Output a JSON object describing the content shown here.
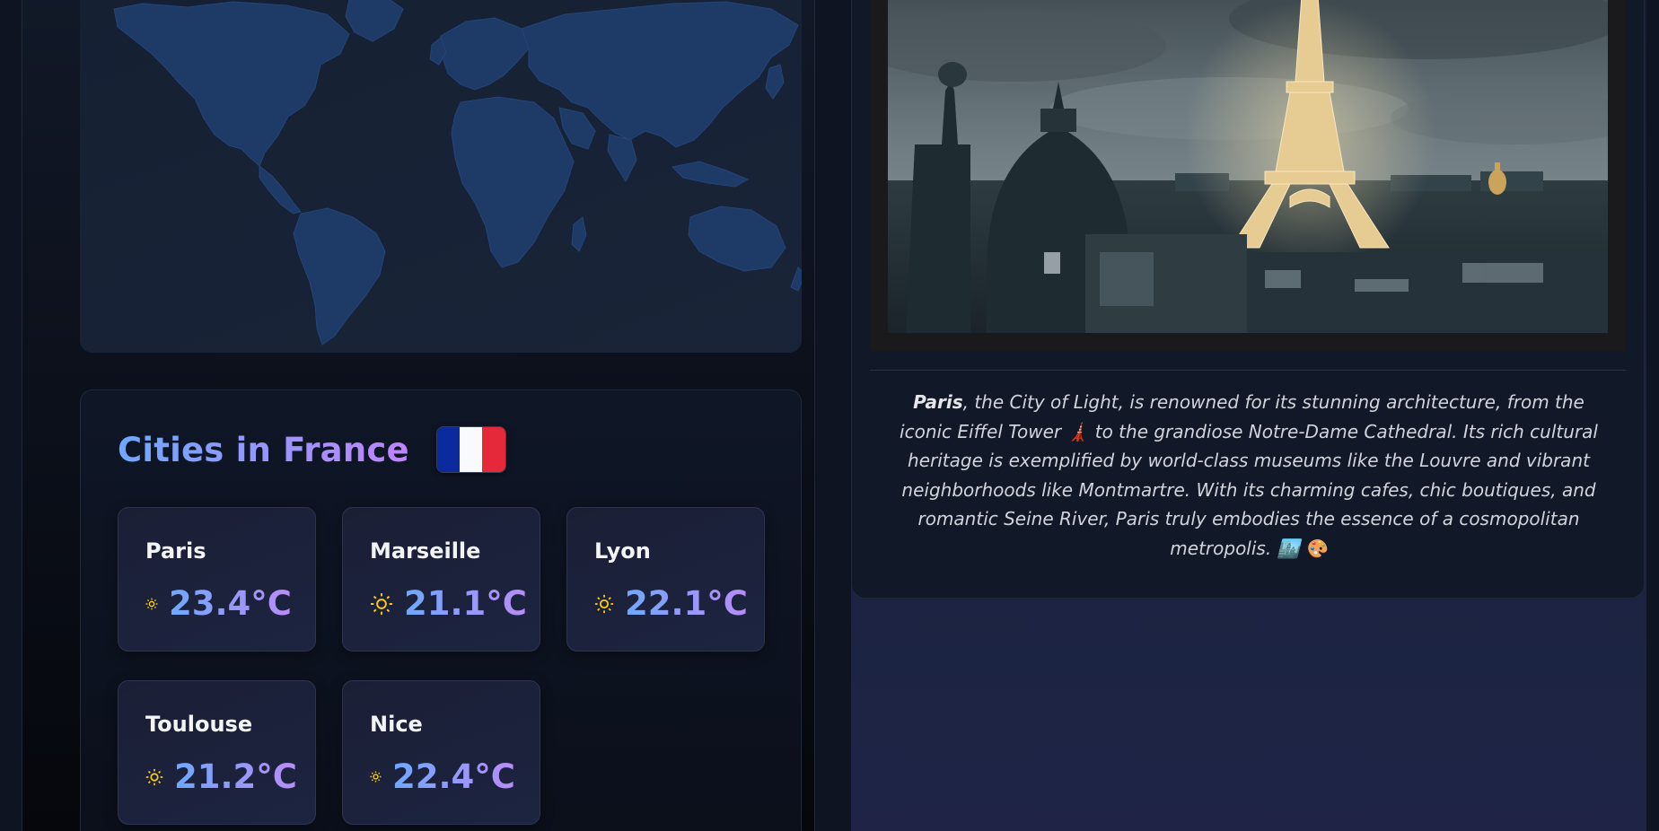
{
  "cities_section": {
    "title": "Cities in France",
    "flag": "france-flag",
    "cities": [
      {
        "name": "Paris",
        "temp": "23.4°C",
        "icon": "sun-icon"
      },
      {
        "name": "Marseille",
        "temp": "21.1°C",
        "icon": "sun-icon"
      },
      {
        "name": "Lyon",
        "temp": "22.1°C",
        "icon": "sun-icon"
      },
      {
        "name": "Toulouse",
        "temp": "21.2°C",
        "icon": "sun-icon"
      },
      {
        "name": "Nice",
        "temp": "22.4°C",
        "icon": "sun-icon"
      }
    ]
  },
  "detail": {
    "photo": "eiffel-tower-photo",
    "description_lead": "Paris",
    "description_body": ", the City of Light, is renowned for its stunning architecture, from the iconic Eiffel Tower 🗼 to the grandiose Notre-Dame Cathedral. Its rich cultural heritage is exemplified by world-class museums like the Louvre and vibrant neighborhoods like Montmartre. With its charming cafes, chic boutiques, and romantic Seine River, Paris truly embodies the essence of a cosmopolitan metropolis. 🏙️ 🎨"
  },
  "colors": {
    "accent_gradient_start": "#6ea8fe",
    "accent_gradient_end": "#c084fc",
    "sun": "#facc15",
    "map_land": "#1e3a66"
  }
}
